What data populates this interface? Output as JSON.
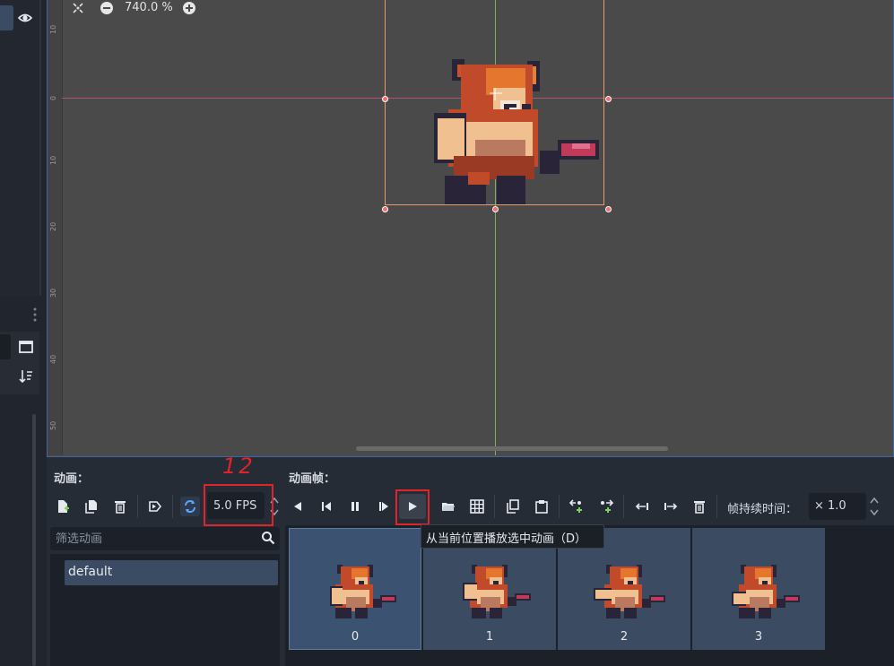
{
  "viewport": {
    "zoom_level": "740.0 %",
    "ruler_labels": [
      "10",
      "0",
      "10",
      "20",
      "30",
      "40",
      "50"
    ]
  },
  "sprite_frames": {
    "animations_label": "动画：",
    "frames_label": "动画帧：",
    "fps_value": "5.0 FPS",
    "frame_duration_label": "帧持续时间：",
    "frame_duration_value": "× 1.0",
    "filter_placeholder": "筛选动画",
    "animation_list": [
      "default"
    ],
    "frames": [
      "0",
      "1",
      "2",
      "3"
    ],
    "play_tooltip": "从当前位置播放选中动画（D）"
  },
  "annotation": {
    "handwritten_text": "12"
  },
  "colors": {
    "accent": "#3b4b63",
    "highlight_red": "#e0242a",
    "selection_border": "#e79a6a"
  }
}
